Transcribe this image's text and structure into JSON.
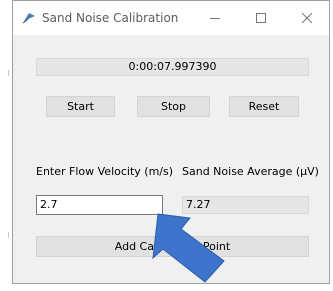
{
  "window": {
    "title": "Sand Noise Calibration",
    "controls": [
      "minimize-icon",
      "maximize-icon",
      "close-icon"
    ]
  },
  "timer": {
    "value": "0:00:07.997390"
  },
  "buttons": {
    "start": "Start",
    "stop": "Stop",
    "reset": "Reset"
  },
  "labels": {
    "flow_velocity": "Enter Flow Velocity (m/s)",
    "noise_average": "Sand Noise Average (µV)"
  },
  "fields": {
    "flow_velocity_value": "2.7",
    "noise_average_value": "7.27"
  },
  "add_button": {
    "label": "Add Calibration Point"
  },
  "annotation": {
    "icon": "pointer-arrow-icon",
    "color": "#3f74cc"
  },
  "colors": {
    "window_bg": "#f0f0f0",
    "button_bg": "#e1e1e1"
  }
}
